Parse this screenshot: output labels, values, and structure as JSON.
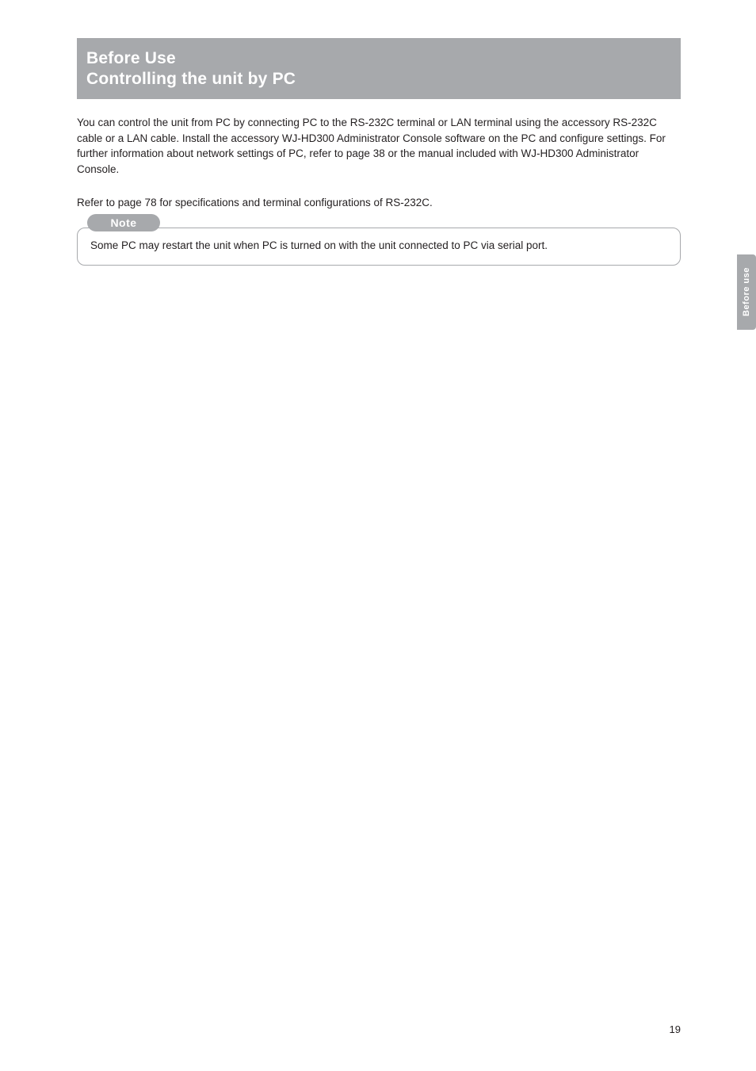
{
  "header": {
    "title": "Before Use",
    "subtitle": "Controlling the unit by PC"
  },
  "intro": "You can control the unit from PC by connecting PC to the RS-232C terminal or LAN terminal using the accessory RS-232C cable or a LAN cable. Install the accessory WJ-HD300 Administrator Console software on the PC and configure settings. For further information about network settings of PC, refer to page 38 or the manual included with WJ-HD300 Administrator Console.",
  "ref": "Refer to page 78 for specifications and terminal configurations of RS-232C.",
  "note": {
    "label": "Note",
    "text": "Some PC may restart the unit when PC is turned on with the unit connected to PC via serial port."
  },
  "side_tab": "Before use",
  "page_number": "19"
}
